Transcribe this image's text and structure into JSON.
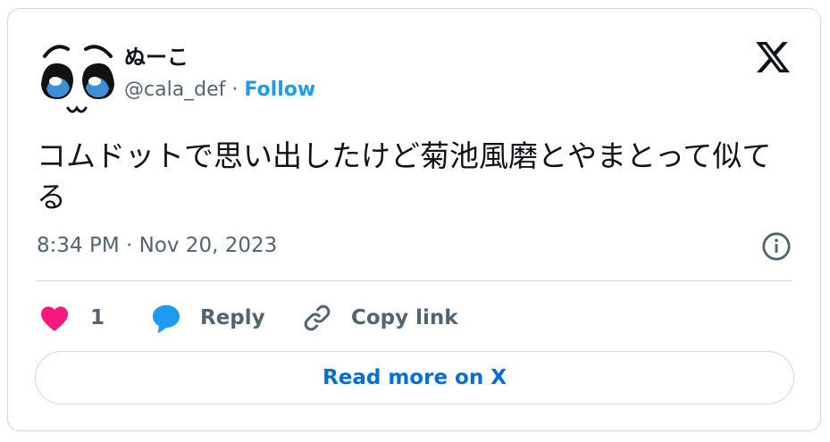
{
  "tweet": {
    "display_name": "ぬーこ",
    "handle": "@cala_def",
    "separator": "·",
    "follow_label": "Follow",
    "text": "コムドットで思い出したけど菊池風磨とやまとって似てる",
    "timestamp": "8:34 PM · Nov 20, 2023"
  },
  "actions": {
    "like_count": "1",
    "reply_label": "Reply",
    "copy_link_label": "Copy link",
    "read_more_label": "Read more on X"
  },
  "icons": {
    "brand": "x-logo-icon",
    "info": "info-icon",
    "like": "heart-icon",
    "reply": "speech-bubble-icon",
    "copy_link": "link-icon"
  },
  "colors": {
    "accent": "#1d9bf0",
    "read_more": "#006fd6",
    "heart": "#f91880",
    "muted_text": "#536471",
    "border": "#cfd9de"
  }
}
